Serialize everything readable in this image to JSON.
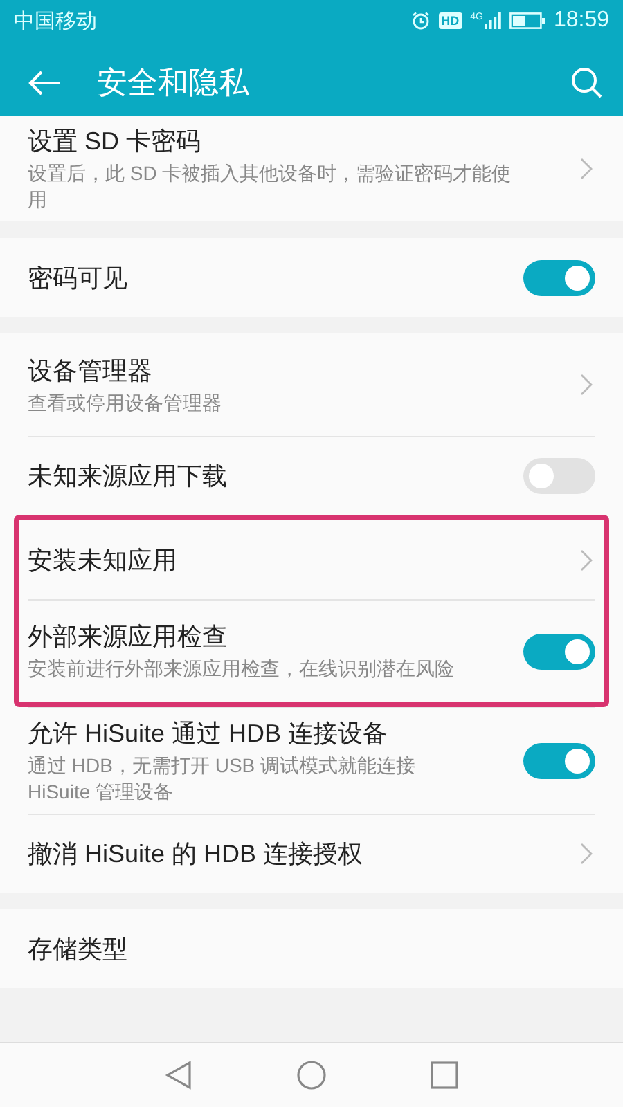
{
  "status_bar": {
    "carrier": "中国移动",
    "hd_badge": "HD",
    "network": "4G",
    "time": "18:59"
  },
  "toolbar": {
    "title": "安全和隐私"
  },
  "sections": [
    {
      "items": [
        {
          "kind": "link",
          "title": "设置 SD 卡密码",
          "subtitle": "设置后，此 SD 卡被插入其他设备时，需验证密码才能使用",
          "highlighted": false
        }
      ]
    },
    {
      "items": [
        {
          "kind": "switch",
          "title": "密码可见",
          "on": true,
          "highlighted": false
        }
      ]
    },
    {
      "items": [
        {
          "kind": "link",
          "title": "设备管理器",
          "subtitle": "查看或停用设备管理器",
          "highlighted": false
        },
        {
          "kind": "switch",
          "title": "未知来源应用下载",
          "on": false,
          "highlighted": false
        },
        {
          "kind": "link",
          "title": "安装未知应用",
          "highlighted": true
        },
        {
          "kind": "switch",
          "title": "外部来源应用检查",
          "subtitle": "安装前进行外部来源应用检查，在线识别潜在风险",
          "on": true,
          "highlighted": true
        },
        {
          "kind": "switch",
          "title": "允许 HiSuite 通过 HDB 连接设备",
          "subtitle": "通过 HDB，无需打开 USB 调试模式就能连接 HiSuite 管理设备",
          "on": true,
          "highlighted": false
        },
        {
          "kind": "link",
          "title": "撤消 HiSuite 的 HDB 连接授权",
          "highlighted": false
        }
      ]
    },
    {
      "items": [
        {
          "kind": "plain",
          "title": "存储类型",
          "highlighted": false
        }
      ]
    }
  ]
}
